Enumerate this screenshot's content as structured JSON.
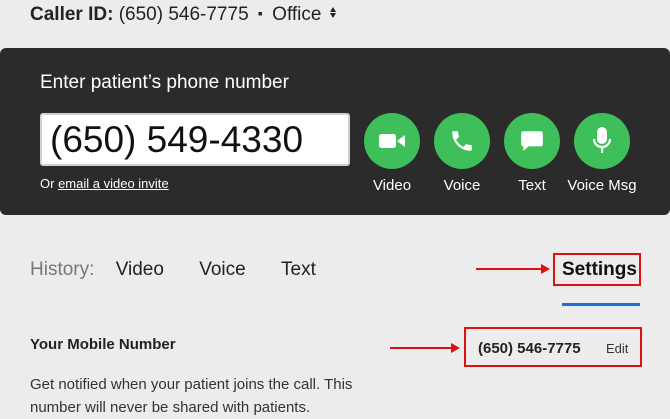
{
  "caller": {
    "label": "Caller ID:",
    "number": "(650) 546-7775",
    "separator": "▪",
    "line": "Office"
  },
  "dialer": {
    "title": "Enter patient’s phone number",
    "phone_value": "(650) 549-4330",
    "invite_prefix": "Or",
    "invite_link": "email a video invite",
    "buttons": [
      {
        "label": "Video",
        "icon": "video-camera-icon"
      },
      {
        "label": "Voice",
        "icon": "phone-handset-icon"
      },
      {
        "label": "Text",
        "icon": "speech-bubble-icon"
      },
      {
        "label": "Voice Msg",
        "icon": "microphone-icon"
      }
    ],
    "button_color": "#3fbf59"
  },
  "history": {
    "label": "History:",
    "tabs": [
      "Video",
      "Voice",
      "Text"
    ],
    "settings_label": "Settings",
    "active_tab": "Settings",
    "active_underline_color": "#1a6fd1"
  },
  "mobile": {
    "heading": "Your Mobile Number",
    "description": "Get notified when your patient joins the call. This number will never be shared with patients.",
    "number": "(650) 546-7775",
    "edit_label": "Edit"
  },
  "annotations": {
    "highlight_color": "#dd1111"
  }
}
